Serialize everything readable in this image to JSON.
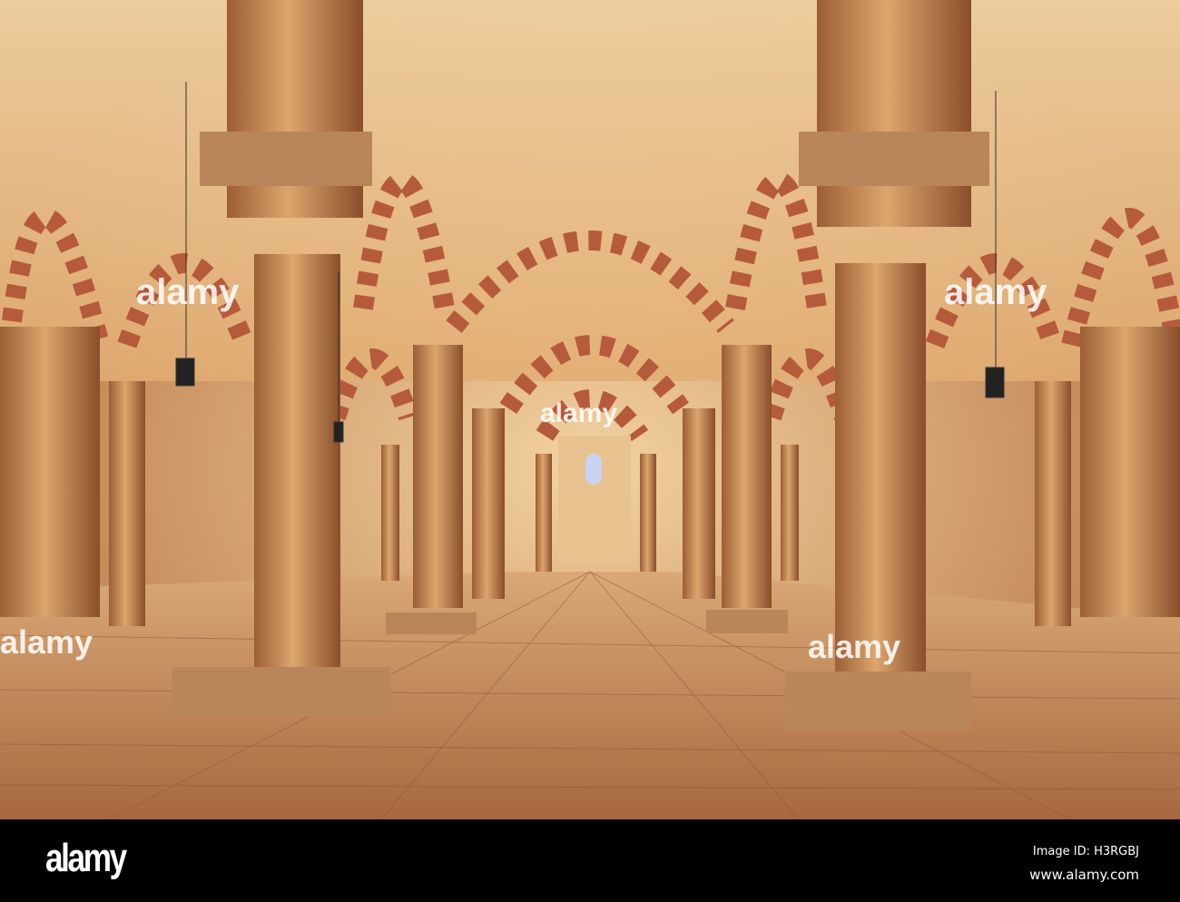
{
  "photo": {
    "subject": "crypt-arcade",
    "palette": {
      "stone": "#d9a066",
      "vault": "#f1d2a0",
      "stripe": "#b65a3c",
      "floor": "#c98f5d",
      "window": "#c9d4f0"
    }
  },
  "watermark": {
    "text": "alamy"
  },
  "footer": {
    "logo": "alamy",
    "image_id": "Image ID: H3RGBJ",
    "website": "www.alamy.com"
  }
}
